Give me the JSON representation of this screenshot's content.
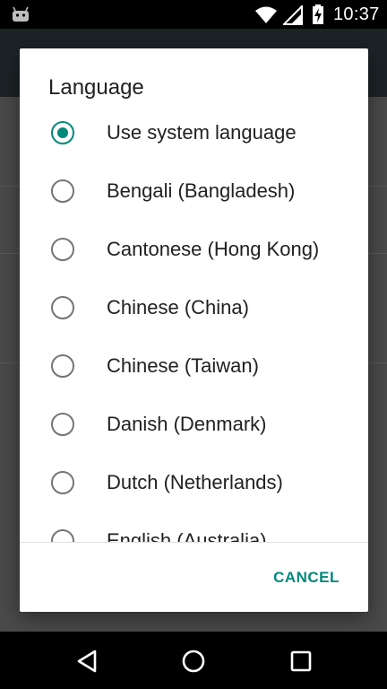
{
  "status_bar": {
    "time": "10:37",
    "icons": [
      "android-icon",
      "wifi-icon",
      "cell-signal-icon",
      "battery-charging-icon"
    ]
  },
  "dialog": {
    "title": "Language",
    "selected_index": 0,
    "options": [
      "Use system language",
      "Bengali (Bangladesh)",
      "Cantonese (Hong Kong)",
      "Chinese (China)",
      "Chinese (Taiwan)",
      "Danish (Denmark)",
      "Dutch (Netherlands)",
      "English (Australia)"
    ],
    "cancel_label": "CANCEL"
  },
  "navigation": {
    "icons": [
      "back-icon",
      "home-icon",
      "recents-icon"
    ]
  },
  "colors": {
    "accent": "#00897b",
    "scrim": "#4d4d4d",
    "status_bar": "#000000"
  }
}
